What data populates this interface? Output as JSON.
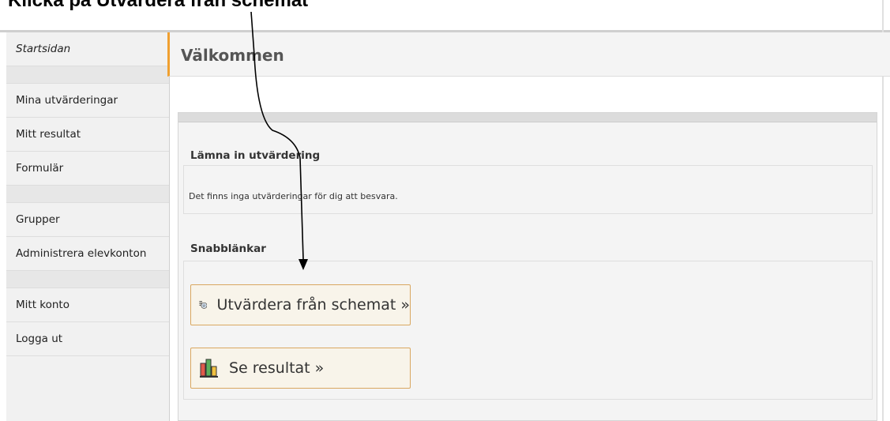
{
  "top_caption": "Klicka på Utvärdera från schemat",
  "sidebar": {
    "items": [
      {
        "label": "Startsidan"
      },
      {
        "label": "Mina utvärderingar"
      },
      {
        "label": "Mitt resultat"
      },
      {
        "label": "Formulär"
      },
      {
        "label": "Grupper"
      },
      {
        "label": "Administrera elevkonton"
      },
      {
        "label": "Mitt konto"
      },
      {
        "label": "Logga ut"
      }
    ]
  },
  "main": {
    "title": "Välkommen",
    "submit_section": {
      "title": "Lämna in utvärdering",
      "message": "Det finns inga utvärderingar för dig att besvara."
    },
    "quicklinks_section": {
      "title": "Snabblänkar",
      "buttons": [
        {
          "label": "Utvärdera från schemat »",
          "icon": "schedule-evaluate-icon"
        },
        {
          "label": "Se resultat »",
          "icon": "bar-chart-icon"
        }
      ]
    }
  },
  "colors": {
    "accent": "#f0a030",
    "button_border": "#d9a760",
    "button_bg": "#f8f4ea",
    "sidebar_bg": "#f1f1f1",
    "panel_bg": "#f4f4f4"
  }
}
